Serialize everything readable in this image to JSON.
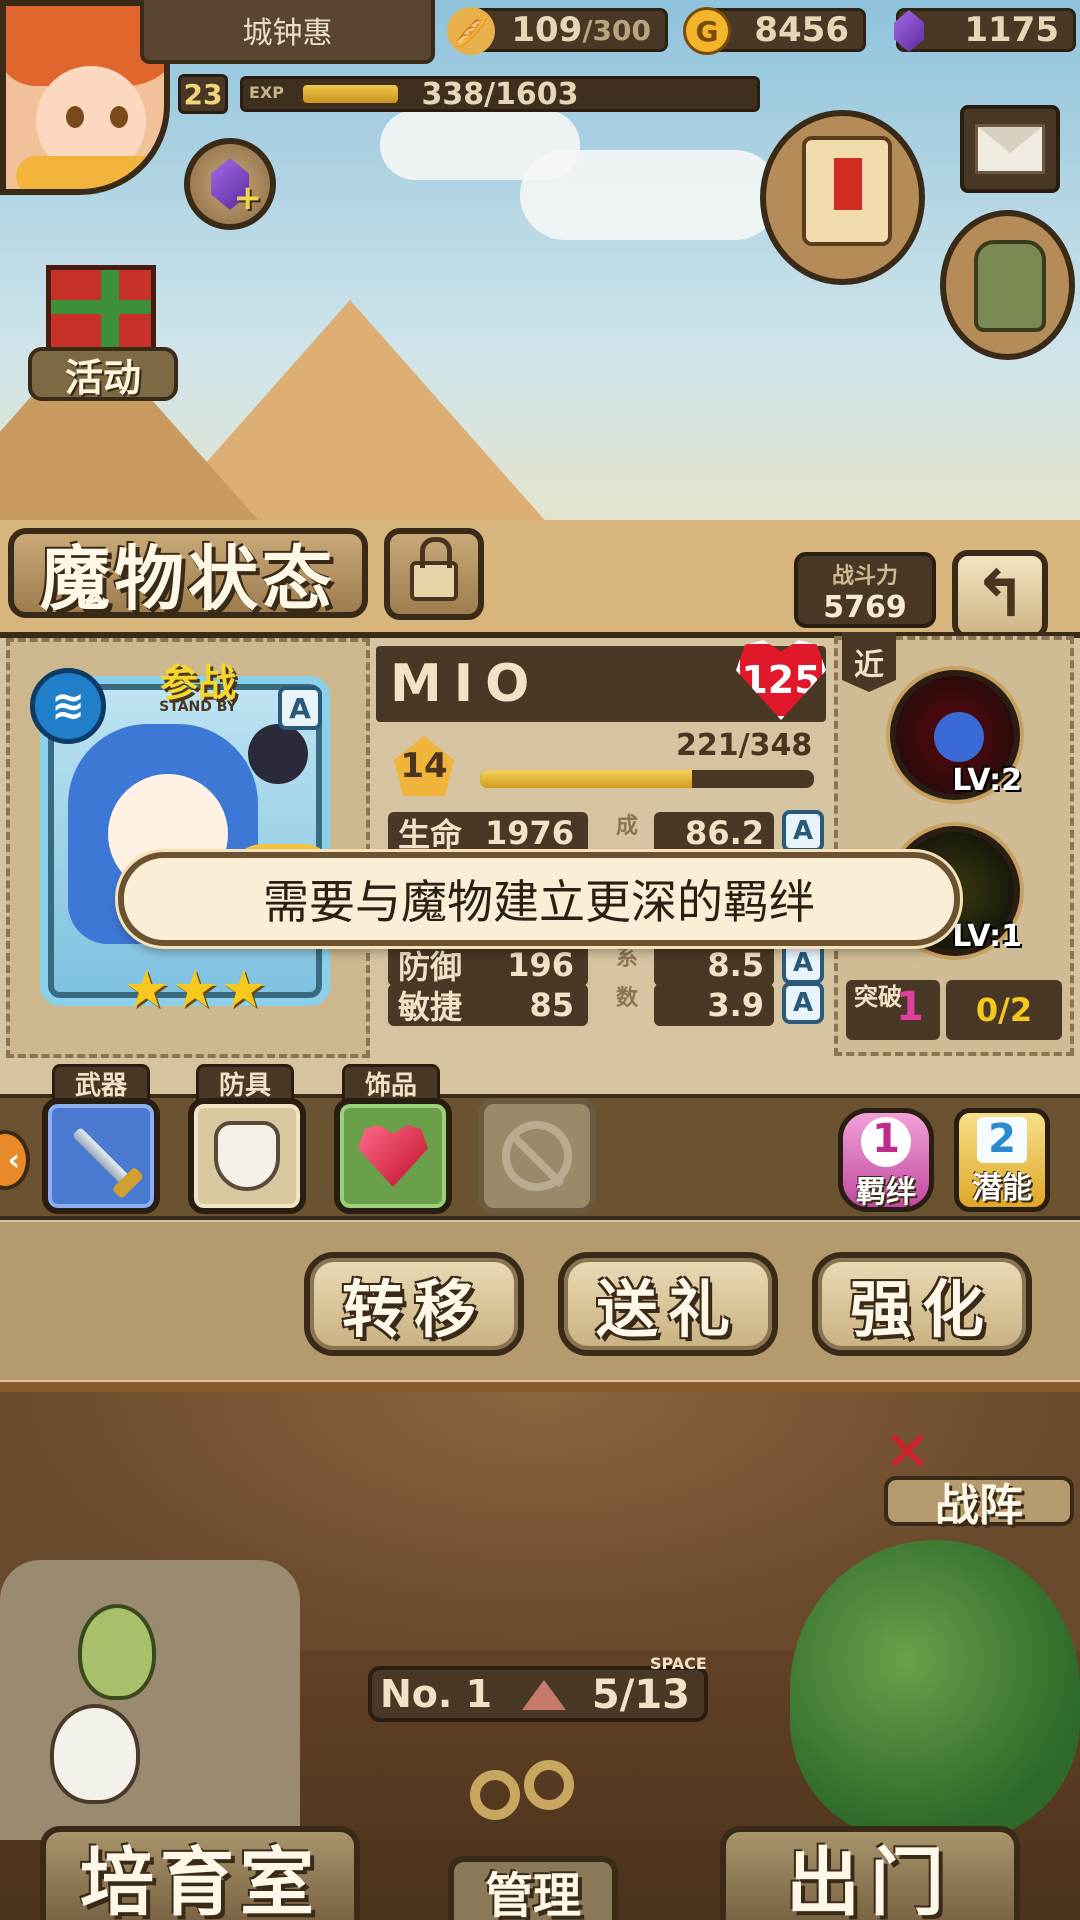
{
  "player": {
    "name": "城钟惠",
    "level": "23",
    "exp_label": "EXP",
    "exp_text": "338/1603",
    "exp_fraction": 0.211
  },
  "resources": {
    "stamina_current": "109",
    "stamina_max": "/300",
    "gold": "8456",
    "gems": "1175"
  },
  "buttons": {
    "event_label": "活动",
    "title": "魔物状态",
    "combat_power_label": "战斗力",
    "combat_power_value": "5769",
    "back_icon": "↰"
  },
  "monster": {
    "name": "MIO",
    "affection": "125",
    "level": "14",
    "exp_text": "221/348",
    "exp_fraction": 0.635,
    "standby_cn": "参战",
    "standby_en": "STAND BY",
    "rank": "A",
    "element_icon": "water-icon",
    "stars": 3,
    "stats": [
      {
        "label": "生命",
        "value": "1976",
        "coef": "86.2",
        "rank": "A"
      },
      {
        "label": "防御",
        "value": "196",
        "coef": "8.5",
        "rank": "A"
      },
      {
        "label": "敏捷",
        "value": "85",
        "coef": "3.9",
        "rank": "A"
      }
    ],
    "coef_chars": [
      "成",
      "系",
      "数"
    ]
  },
  "skills": {
    "range_tag": "近",
    "items": [
      {
        "icon": "paw-skill-icon",
        "level": "LV:2"
      },
      {
        "icon": "dash-skill-icon",
        "level": "LV:1"
      }
    ],
    "breakthrough_label": "突破",
    "breakthrough_value": "1",
    "breakthrough_progress": "0/2"
  },
  "equipment": {
    "tabs": [
      "武器",
      "防具",
      "饰品"
    ],
    "bond_count": "1",
    "bond_label": "羁绊",
    "potential_count": "2",
    "potential_label": "潜能"
  },
  "actions": [
    "转移",
    "送礼",
    "强化"
  ],
  "toast": "需要与魔物建立更深的羁绊",
  "lower": {
    "formation_label": "战阵",
    "room_no": "No. 1",
    "space_label": "SPACE",
    "space_value": "5/13",
    "nav_breed": "培育室",
    "nav_manage": "管理",
    "nav_out": "出门"
  },
  "colors": {
    "accent_gold": "#f5c81e",
    "panel_brown": "#4a3826",
    "heart_red": "#e0182a",
    "bond_pink": "#c04aa0"
  }
}
